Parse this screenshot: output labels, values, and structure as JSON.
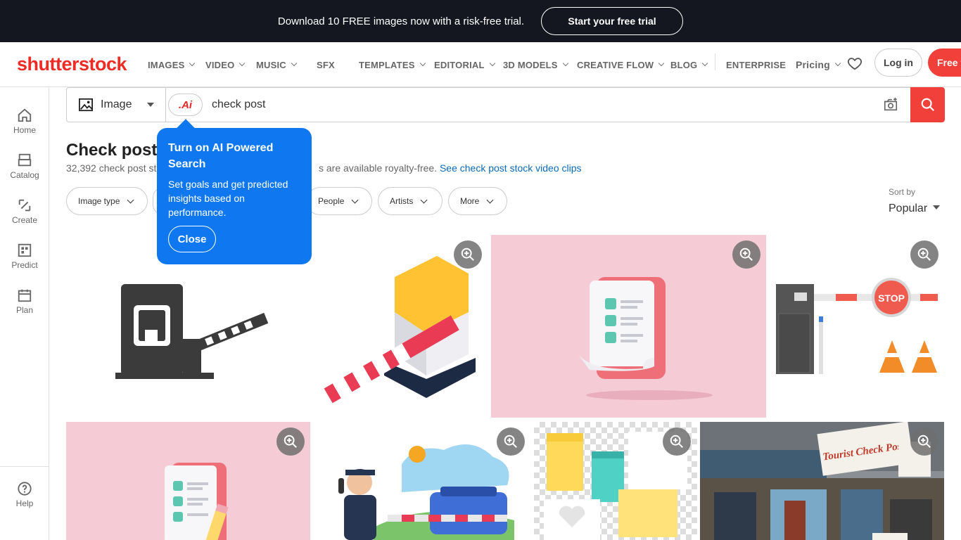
{
  "promo": {
    "text": "Download 10 FREE images now with a risk-free trial.",
    "button": "Start your free trial"
  },
  "header": {
    "logo": "shutterstock",
    "nav": [
      "IMAGES",
      "VIDEO",
      "MUSIC",
      "SFX",
      "TEMPLATES",
      "EDITORIAL",
      "3D MODELS",
      "CREATIVE FLOW",
      "BLOG",
      "ENTERPRISE",
      "Pricing"
    ],
    "login": "Log in",
    "free": "Free t"
  },
  "sidebar": {
    "items": [
      "Home",
      "Catalog",
      "Create",
      "Predict",
      "Plan"
    ],
    "help": "Help"
  },
  "search": {
    "type": "Image",
    "ai_label": ".Ai",
    "query": "check post"
  },
  "results": {
    "title": "Check post",
    "count_text": "32,392 check post st",
    "count_text_tail": "s are available royalty-free.",
    "video_link": "See check post stock video clips"
  },
  "filters": [
    "Image type",
    "People",
    "Artists",
    "More"
  ],
  "sort": {
    "label": "Sort by",
    "value": "Popular"
  },
  "tooltip": {
    "title": "Turn on AI Powered Search",
    "body": "Set goals and get predicted insights based on performance.",
    "close": "Close"
  },
  "images": [
    {
      "alt": "checkpoint barrier icon"
    },
    {
      "alt": "isometric barrier gate"
    },
    {
      "alt": "checklist document 3d"
    },
    {
      "alt": "barrier with stop sign and cones",
      "stop_text": "STOP"
    },
    {
      "alt": "checklist with pencil"
    },
    {
      "alt": "police officer at checkpoint"
    },
    {
      "alt": "sticky notes"
    },
    {
      "alt": "tourist check post photo",
      "sign_text": "Tourist Check Post"
    }
  ],
  "colors": {
    "brand": "#f1403a",
    "tooltip": "#0f78f0",
    "promo_bg": "#14171f",
    "link": "#0b6ab8"
  }
}
